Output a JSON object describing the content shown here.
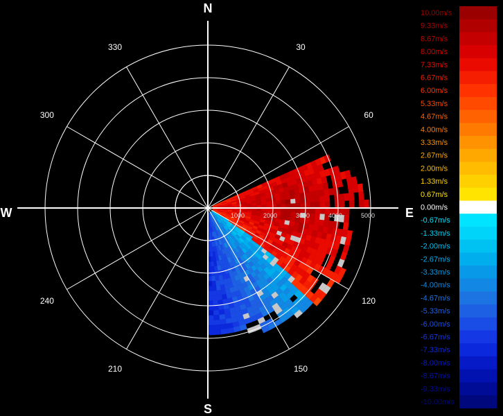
{
  "compass": {
    "north": "N",
    "east": "E",
    "south": "S",
    "west": "W"
  },
  "azimuth_labels": [
    {
      "deg": 30,
      "text": "30"
    },
    {
      "deg": 60,
      "text": "60"
    },
    {
      "deg": 120,
      "text": "120"
    },
    {
      "deg": 150,
      "text": "150"
    },
    {
      "deg": 210,
      "text": "210"
    },
    {
      "deg": 240,
      "text": "240"
    },
    {
      "deg": 300,
      "text": "300"
    },
    {
      "deg": 330,
      "text": "330"
    }
  ],
  "range_labels": [
    {
      "value": 1000,
      "text": "1000"
    },
    {
      "value": 2000,
      "text": "2000"
    },
    {
      "value": 3000,
      "text": "3000"
    },
    {
      "value": 4000,
      "text": "4000"
    },
    {
      "value": 5000,
      "text": "5000"
    }
  ],
  "colors": {
    "background": "#000000",
    "grid": "#ffffff",
    "no_data_gray": "#c8c8c8"
  },
  "legend": [
    {
      "label": "10.00m/s",
      "color": "#9b0000"
    },
    {
      "label": "9.33m/s",
      "color": "#b00000"
    },
    {
      "label": "8.67m/s",
      "color": "#c40000"
    },
    {
      "label": "8.00m/s",
      "color": "#d80000"
    },
    {
      "label": "7.33m/s",
      "color": "#ea0a00"
    },
    {
      "label": "6.67m/s",
      "color": "#f51e00"
    },
    {
      "label": "6.00m/s",
      "color": "#ff3200"
    },
    {
      "label": "5.33m/s",
      "color": "#ff4a00"
    },
    {
      "label": "4.67m/s",
      "color": "#ff6200"
    },
    {
      "label": "4.00m/s",
      "color": "#ff7a00"
    },
    {
      "label": "3.33m/s",
      "color": "#ff9200"
    },
    {
      "label": "2.67m/s",
      "color": "#ffa800"
    },
    {
      "label": "2.00m/s",
      "color": "#ffbc00"
    },
    {
      "label": "1.33m/s",
      "color": "#ffd000"
    },
    {
      "label": "0.67m/s",
      "color": "#ffe400"
    },
    {
      "label": "0.00m/s",
      "color": "#ffffff"
    },
    {
      "label": "-0.67m/s",
      "color": "#00e4ff"
    },
    {
      "label": "-1.33m/s",
      "color": "#00d4f8"
    },
    {
      "label": "-2.00m/s",
      "color": "#00c2f2"
    },
    {
      "label": "-2.67m/s",
      "color": "#00aeee"
    },
    {
      "label": "-3.33m/s",
      "color": "#089ae8"
    },
    {
      "label": "-4.00m/s",
      "color": "#1288e4"
    },
    {
      "label": "-4.67m/s",
      "color": "#1c74e2"
    },
    {
      "label": "-5.33m/s",
      "color": "#1e60e4"
    },
    {
      "label": "-6.00m/s",
      "color": "#1a4ce6"
    },
    {
      "label": "-6.67m/s",
      "color": "#1438e4"
    },
    {
      "label": "-7.33m/s",
      "color": "#0c28dc"
    },
    {
      "label": "-8.00m/s",
      "color": "#061ac8"
    },
    {
      "label": "-8.67m/s",
      "color": "#0212b0"
    },
    {
      "label": "-9.33m/s",
      "color": "#000c96"
    },
    {
      "label": "-10.00m/s",
      "color": "#00087e"
    }
  ]
}
